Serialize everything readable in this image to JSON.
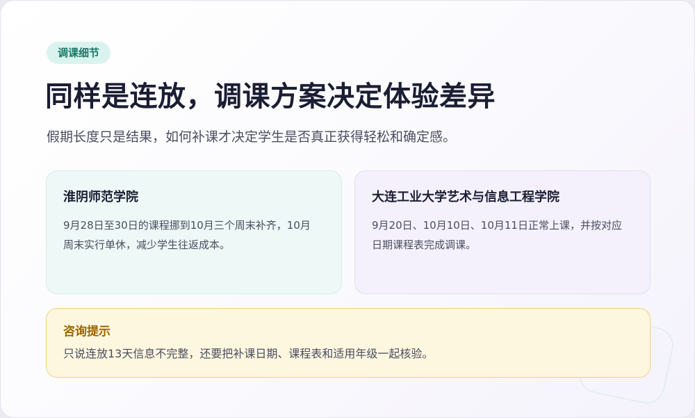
{
  "tag": "调课细节",
  "title": "同样是连放，调课方案决定体验差异",
  "subtitle": "假期长度只是结果，如何补课才决定学生是否真正获得轻松和确定感。",
  "schools": [
    {
      "name": "淮阴师范学院",
      "desc": "9月28日至30日的课程挪到10月三个周末补齐，10月周末实行单休，减少学生往返成本。",
      "accent": "#eef8f6"
    },
    {
      "name": "大连工业大学艺术与信息工程学院",
      "desc": "9月20日、10月10日、10月11日正常上课，并按对应日期课程表完成调课。",
      "accent": "#f4f1fc"
    }
  ],
  "tip": {
    "title": "咨询提示",
    "text": "只说连放13天信息不完整，还要把补课日期、课程表和适用年级一起核验。",
    "accent": "#fef7e0"
  }
}
